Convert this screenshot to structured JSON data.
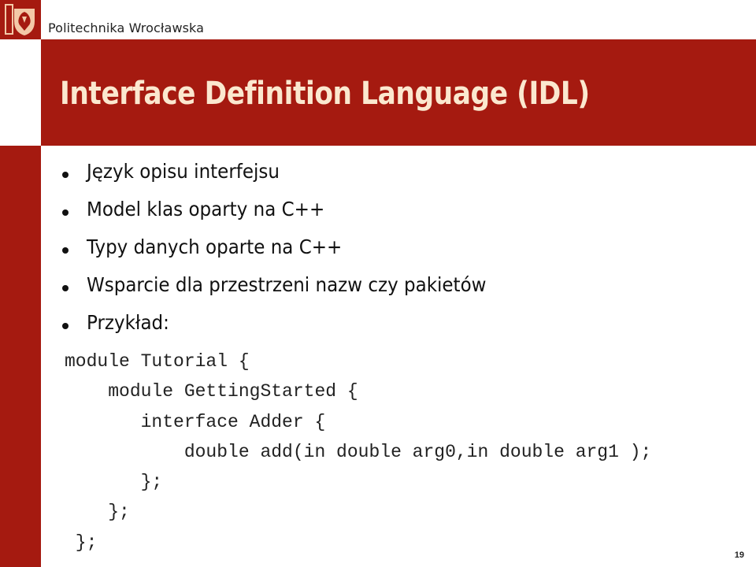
{
  "header": {
    "brand_name": "Politechnika Wrocławska",
    "logo_icon": "eagle-crest-icon"
  },
  "slide": {
    "title": "Interface Definition Language (IDL)",
    "bullets": [
      "Język opisu interfejsu",
      "Model klas oparty na C++",
      "Typy danych oparte na C++",
      "Wsparcie dla przestrzeni nazw czy pakietów",
      "Przykład:"
    ],
    "code_lines": [
      "module Tutorial {",
      "    module GettingStarted {",
      "       interface Adder {",
      "           double add(in double arg0,in double arg1 );",
      "       };",
      "    };",
      " };"
    ],
    "page_number": "19"
  },
  "colors": {
    "brand_red": "#a51a10",
    "title_text": "#fbe8cf"
  }
}
